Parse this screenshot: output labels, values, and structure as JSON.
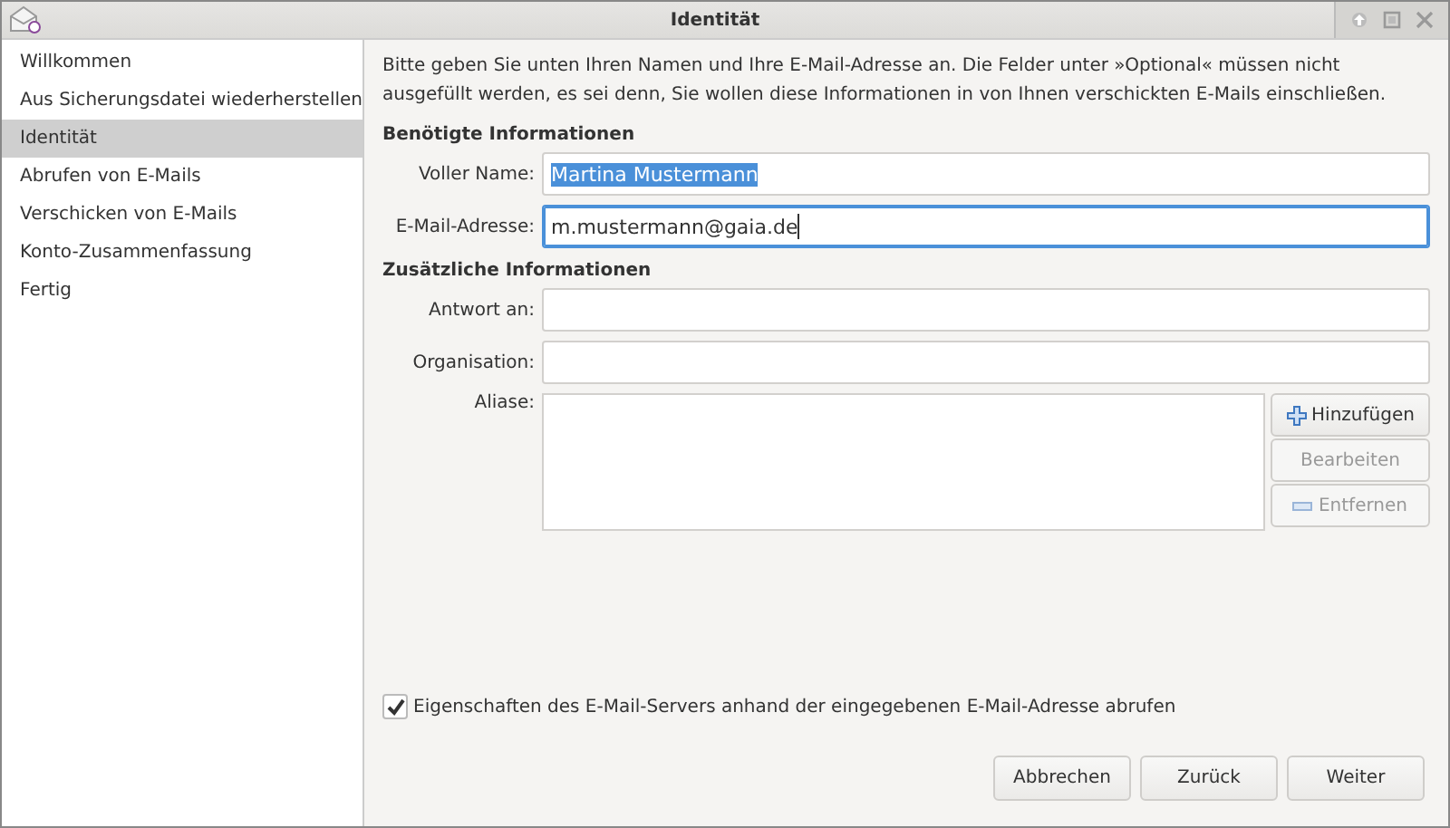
{
  "window": {
    "title": "Identität"
  },
  "sidebar": {
    "items": [
      {
        "label": "Willkommen",
        "selected": false
      },
      {
        "label": "Aus Sicherungsdatei wiederherstellen",
        "selected": false
      },
      {
        "label": "Identität",
        "selected": true
      },
      {
        "label": "Abrufen von E-Mails",
        "selected": false
      },
      {
        "label": "Verschicken von E-Mails",
        "selected": false
      },
      {
        "label": "Konto-Zusammenfassung",
        "selected": false
      },
      {
        "label": "Fertig",
        "selected": false
      }
    ]
  },
  "intro": "Bitte geben Sie unten Ihren Namen und Ihre E-Mail-Adresse an. Die Felder unter »Optional« müssen nicht ausgefüllt werden, es sei denn, Sie wollen diese Informationen in von Ihnen verschickten E-Mails einschließen.",
  "sections": [
    {
      "heading": "Benötigte Informationen",
      "fields": [
        {
          "label": "Voller Name:",
          "value": "Martina Mustermann",
          "focused": false,
          "text_selected": true
        },
        {
          "label": "E-Mail-Adresse:",
          "value": "m.mustermann@gaia.de",
          "focused": true,
          "text_selected": false
        }
      ]
    },
    {
      "heading": "Zusätzliche Informationen",
      "fields": [
        {
          "label": "Antwort an:",
          "focused": false
        },
        {
          "label": "Organisation:",
          "focused": false
        }
      ]
    }
  ],
  "aliases": {
    "label": "Aliase:",
    "buttons": [
      {
        "label": "Hinzufügen",
        "kind": "add",
        "disabled": false
      },
      {
        "label": "Bearbeiten",
        "kind": "edit",
        "disabled": true
      },
      {
        "label": "Entfernen",
        "kind": "remove",
        "disabled": true
      }
    ]
  },
  "option": {
    "label": "Eigenschaften des E-Mail-Servers anhand der eingegebenen E-Mail-Adresse abrufen",
    "checked": true
  },
  "buttons": [
    "Abbrechen",
    "Zurück",
    "Weiter"
  ]
}
